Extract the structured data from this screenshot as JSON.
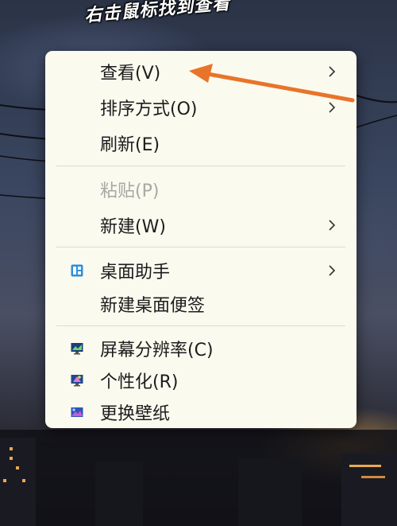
{
  "caption": "右击鼠标找到查看",
  "menu": {
    "items": [
      {
        "id": "view",
        "label": "查看(V)",
        "submenu": true,
        "enabled": true
      },
      {
        "id": "sort",
        "label": "排序方式(O)",
        "submenu": true,
        "enabled": true
      },
      {
        "id": "refresh",
        "label": "刷新(E)",
        "submenu": false,
        "enabled": true
      },
      {
        "id": "paste",
        "label": "粘贴(P)",
        "submenu": false,
        "enabled": false
      },
      {
        "id": "new",
        "label": "新建(W)",
        "submenu": true,
        "enabled": true
      },
      {
        "id": "desktop-assistant",
        "label": "桌面助手",
        "submenu": true,
        "enabled": true,
        "icon": "desktop-assistant-icon"
      },
      {
        "id": "new-sticky-note",
        "label": "新建桌面便签",
        "submenu": false,
        "enabled": true
      },
      {
        "id": "resolution",
        "label": "屏幕分辨率(C)",
        "submenu": false,
        "enabled": true,
        "icon": "monitor-resolution-icon"
      },
      {
        "id": "personalize",
        "label": "个性化(R)",
        "submenu": false,
        "enabled": true,
        "icon": "personalize-icon"
      },
      {
        "id": "wallpaper",
        "label": "更换壁纸",
        "submenu": false,
        "enabled": true,
        "icon": "wallpaper-icon"
      }
    ]
  },
  "colors": {
    "menu_bg": "#fbfaef",
    "text": "#1c1c1c",
    "disabled_text": "#a8a8a4",
    "annotation_arrow": "#e8742a"
  }
}
